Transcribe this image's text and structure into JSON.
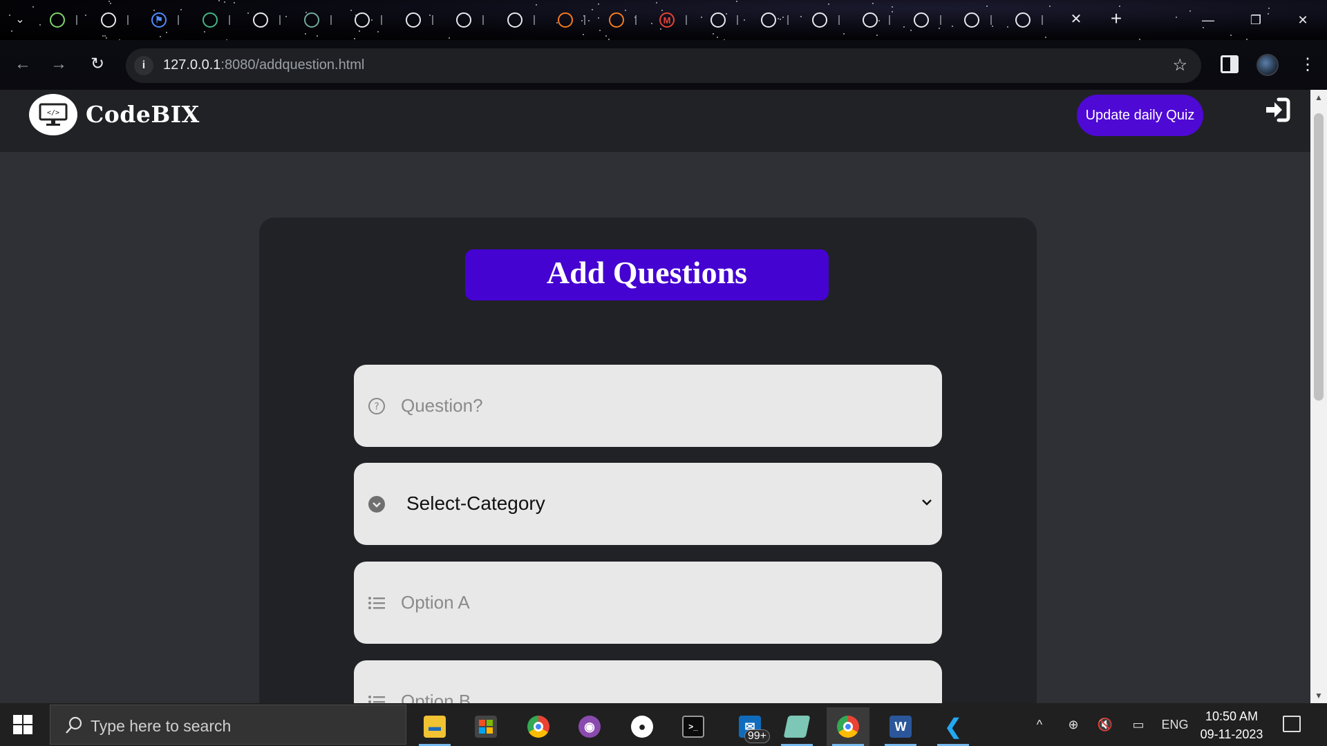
{
  "browser": {
    "tabs": [
      {
        "icon": "umbrella-icon",
        "color": "#7fd36a"
      },
      {
        "icon": "globe-icon",
        "color": "#e8eaed"
      },
      {
        "icon": "flag-icon",
        "color": "#4f8cff"
      },
      {
        "icon": "vue-icon",
        "color": "#41b883"
      },
      {
        "icon": "globe-icon",
        "color": "#e8eaed"
      },
      {
        "icon": "chatgpt-icon",
        "color": "#74aa9c"
      },
      {
        "icon": "chrome-icon",
        "color": "#e8eaed"
      },
      {
        "icon": "globe-icon",
        "color": "#e8eaed"
      },
      {
        "icon": "globe-icon",
        "color": "#e8eaed"
      },
      {
        "icon": "globe-icon",
        "color": "#e8eaed"
      },
      {
        "icon": "orange-blocks-icon",
        "color": "#f47a1f"
      },
      {
        "icon": "orange-blocks-icon",
        "color": "#f47a1f"
      },
      {
        "icon": "gmail-icon",
        "color": "#ea4335"
      },
      {
        "icon": "globe-icon",
        "color": "#e8eaed"
      },
      {
        "icon": "globe-icon",
        "color": "#e8eaed"
      },
      {
        "icon": "globe-icon",
        "color": "#e8eaed"
      },
      {
        "icon": "globe-icon",
        "color": "#e8eaed"
      },
      {
        "icon": "globe-icon",
        "color": "#e8eaed"
      },
      {
        "icon": "globe-icon",
        "color": "#e8eaed"
      },
      {
        "icon": "globe-icon",
        "color": "#e8eaed"
      }
    ],
    "url_host": "127.0.0.1",
    "url_rest": ":8080/addquestion.html"
  },
  "site": {
    "brand": "CodeBIX",
    "update_button": "Update daily Quiz",
    "accent_color": "#4f09d4"
  },
  "form": {
    "heading": "Add Questions",
    "question_placeholder": "Question?",
    "category_label": "Select-Category",
    "option_a_placeholder": "Option A",
    "option_b_placeholder": "Option B"
  },
  "taskbar": {
    "search_placeholder": "Type here to search",
    "mail_badge": "99+",
    "language": "ENG",
    "time": "10:50 AM",
    "date": "09-11-2023"
  }
}
